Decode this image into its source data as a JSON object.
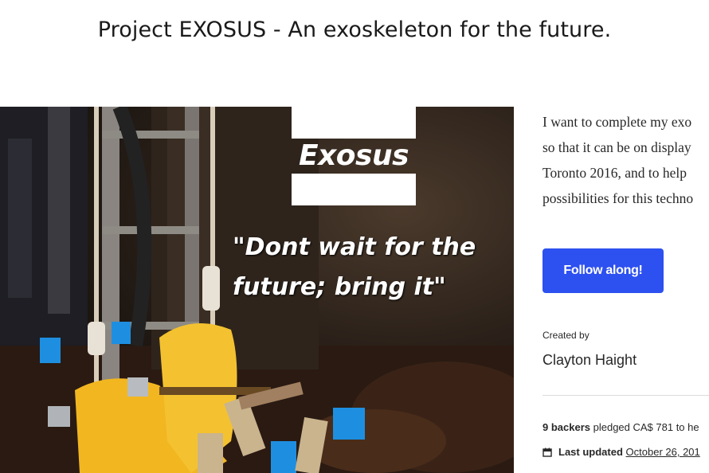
{
  "page": {
    "title": "Project EXOSUS - An exoskeleton for the future."
  },
  "hero": {
    "logo_text": "Exosus",
    "quote_line1": "\"Dont wait for the",
    "quote_line2": "future; bring it\""
  },
  "sidebar": {
    "blurb_lines": [
      "I want to complete my exo",
      "so that it can be on display",
      "Toronto 2016, and to help",
      "possibilities for this techno"
    ],
    "follow_button": "Follow along!",
    "created_by_label": "Created by",
    "creator_name": "Clayton Haight",
    "backers_count": "9 backers",
    "backers_rest": " pledged CA$ 781 to he",
    "last_updated_label": "Last updated",
    "last_updated_date": "October 26, 201"
  },
  "colors": {
    "accent": "#2d50f0",
    "swing_seat": "#f2b620",
    "clamp_blue": "#1e8fe0"
  },
  "icons": {
    "calendar": "calendar-icon"
  }
}
